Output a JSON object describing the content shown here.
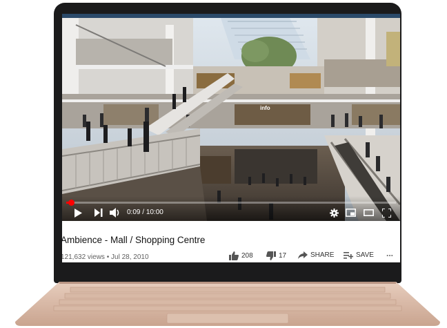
{
  "player": {
    "current_time": "0:09",
    "duration": "10:00",
    "time_separator": "/",
    "progress": 0.015
  },
  "video": {
    "sign_text": "info",
    "title": "Ambience - Mall / Shopping Centre",
    "views": "121,632 views",
    "separator": "•",
    "date": "Jul 28, 2010"
  },
  "actions": {
    "like_count": "208",
    "dislike_count": "17",
    "share_label": "SHARE",
    "save_label": "SAVE",
    "more_label": "..."
  },
  "colors": {
    "progress": "#ff0000",
    "laptop_body": "#d9b8a4",
    "bezel": "#1b1b1c"
  },
  "icons": [
    "play-icon",
    "next-icon",
    "volume-icon",
    "settings-icon",
    "miniplayer-icon",
    "theater-icon",
    "fullscreen-icon",
    "like-icon",
    "dislike-icon",
    "share-icon",
    "save-playlist-icon",
    "more-icon"
  ]
}
